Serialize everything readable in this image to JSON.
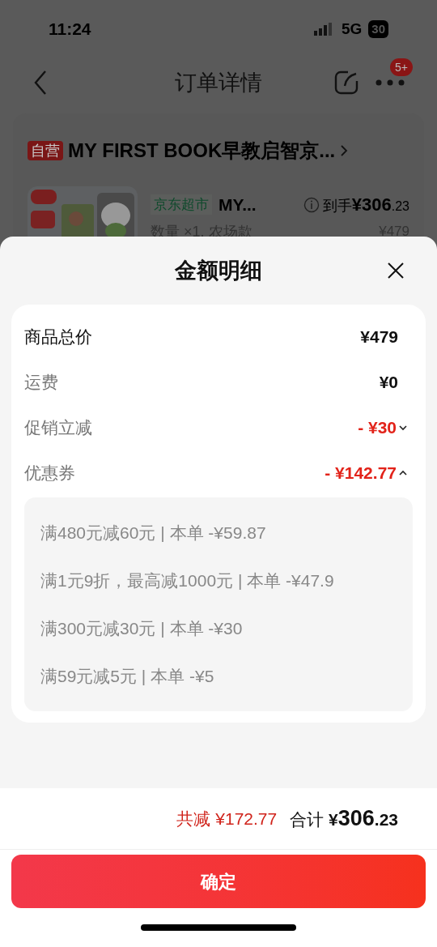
{
  "status_bar": {
    "time": "11:24",
    "network": "5G",
    "battery": "30"
  },
  "nav": {
    "title": "订单详情",
    "badge": "5+"
  },
  "order": {
    "store_tag": "自营",
    "store_name": "MY FIRST BOOK早教启智京...",
    "product": {
      "kind": "picture",
      "tag": "京东超市",
      "name": "MY...",
      "final_price_label": "到手",
      "final_price_int": "¥306",
      "final_price_dec": ".23",
      "spec": "数量 ×1, 农场款",
      "original_price": "¥479"
    }
  },
  "sheet": {
    "title": "金额明细",
    "rows": [
      {
        "kind": "total",
        "label": "商品总价",
        "value": "¥479"
      },
      {
        "kind": "plain",
        "label": "运费",
        "value": "¥0"
      },
      {
        "kind": "discount",
        "label": "促销立减",
        "value": "- ¥30",
        "expanded": false
      },
      {
        "kind": "discount",
        "label": "优惠券",
        "value": "- ¥142.77",
        "expanded": true,
        "details": [
          "满480元减60元 | 本单 -¥59.87",
          "满1元9折，最高减1000元 | 本单 -¥47.9",
          "满300元减30元 | 本单 -¥30",
          "满59元减5元 | 本单 -¥5"
        ]
      }
    ],
    "saved": "共减 ¥172.77",
    "total_label": "合计",
    "total_int": "¥306",
    "total_dec": ".23",
    "confirm": "确定"
  }
}
